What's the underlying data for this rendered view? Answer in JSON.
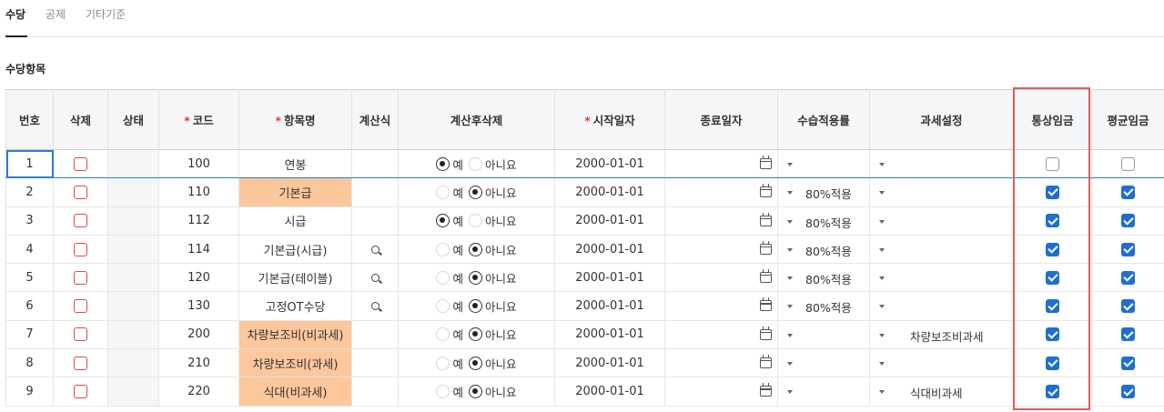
{
  "tabs": [
    "수당",
    "공제",
    "기타기준"
  ],
  "section_title": "수당항목",
  "headers": {
    "no": "번호",
    "delete": "삭제",
    "status": "상태",
    "code": "코드",
    "item_name": "항목명",
    "formula": "계산식",
    "delete_after_calc": "계산후삭제",
    "start_date": "시작일자",
    "end_date": "종료일자",
    "trainee_rate": "수습적용률",
    "tax_setting": "과세설정",
    "ordinary_wage": "통상임금",
    "average_wage": "평균임금",
    "required_mark": "*"
  },
  "radio_labels": {
    "yes": "예",
    "no": "아니요"
  },
  "colors": {
    "accent": "#1f6fd1",
    "highlight": "#fcc79b",
    "required": "#e33c3c",
    "frame": "#e15b5b"
  },
  "rows": [
    {
      "no": "1",
      "code": "100",
      "name": "연봉",
      "highlight": false,
      "formula": false,
      "delete_after": "yes",
      "start": "2000-01-01",
      "rate": "",
      "tax": "",
      "ordinary": false,
      "average": false
    },
    {
      "no": "2",
      "code": "110",
      "name": "기본급",
      "highlight": true,
      "formula": false,
      "delete_after": "no",
      "start": "2000-01-01",
      "rate": "80%적용",
      "tax": "",
      "ordinary": true,
      "average": true
    },
    {
      "no": "3",
      "code": "112",
      "name": "시급",
      "highlight": false,
      "formula": false,
      "delete_after": "yes",
      "start": "2000-01-01",
      "rate": "80%적용",
      "tax": "",
      "ordinary": true,
      "average": true
    },
    {
      "no": "4",
      "code": "114",
      "name": "기본급(시급)",
      "highlight": false,
      "formula": true,
      "delete_after": "no",
      "start": "2000-01-01",
      "rate": "80%적용",
      "tax": "",
      "ordinary": true,
      "average": true
    },
    {
      "no": "5",
      "code": "120",
      "name": "기본급(테이블)",
      "highlight": false,
      "formula": true,
      "delete_after": "no",
      "start": "2000-01-01",
      "rate": "80%적용",
      "tax": "",
      "ordinary": true,
      "average": true
    },
    {
      "no": "6",
      "code": "130",
      "name": "고정OT수당",
      "highlight": false,
      "formula": true,
      "delete_after": "no",
      "start": "2000-01-01",
      "rate": "80%적용",
      "tax": "",
      "ordinary": true,
      "average": true
    },
    {
      "no": "7",
      "code": "200",
      "name": "차량보조비(비과세)",
      "highlight": true,
      "formula": false,
      "delete_after": "no",
      "start": "2000-01-01",
      "rate": "",
      "tax": "차량보조비과세",
      "ordinary": true,
      "average": true
    },
    {
      "no": "8",
      "code": "210",
      "name": "차량보조비(과세)",
      "highlight": true,
      "formula": false,
      "delete_after": "no",
      "start": "2000-01-01",
      "rate": "",
      "tax": "",
      "ordinary": true,
      "average": true
    },
    {
      "no": "9",
      "code": "220",
      "name": "식대(비과세)",
      "highlight": true,
      "formula": false,
      "delete_after": "no",
      "start": "2000-01-01",
      "rate": "",
      "tax": "식대비과세",
      "ordinary": true,
      "average": true
    }
  ]
}
